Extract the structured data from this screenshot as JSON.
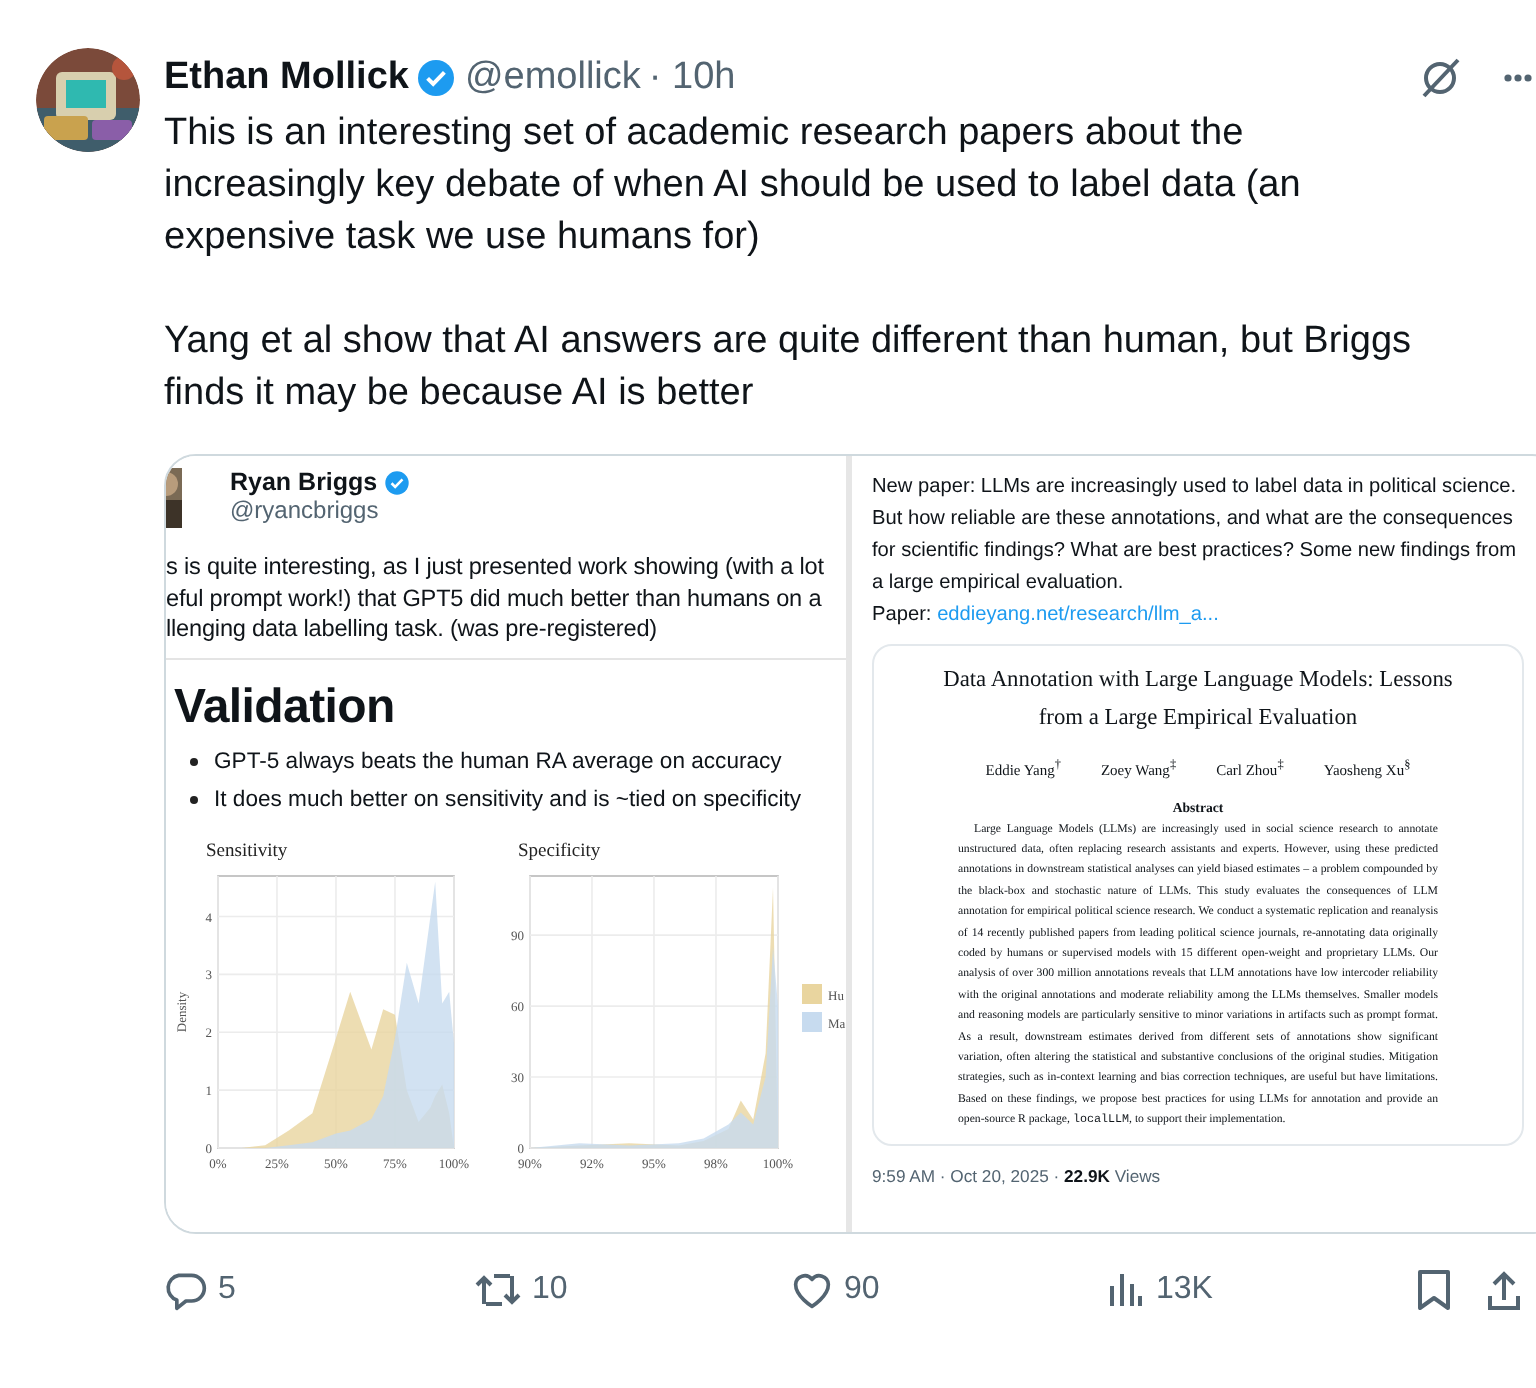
{
  "post": {
    "author": {
      "name": "Ethan Mollick",
      "verified": true,
      "handle": "@emollick",
      "time": "· 10h"
    },
    "paragraphs": [
      [
        "This is an interesting set of academic research papers about the",
        "increasingly key debate of when AI should be used to label data (an",
        "expensive task we use humans for)"
      ],
      [
        "Yang et al show that AI answers are quite different than human, but Briggs",
        "finds it may be because AI is better"
      ]
    ],
    "media": {
      "left": {
        "author": {
          "name": "Ryan Briggs",
          "verified": true,
          "handle": "@ryancbriggs"
        },
        "lines": [
          "s is quite interesting, as I just presented work showing (with a lot",
          "eful prompt work!) that GPT5 did much better than humans on a",
          "llenging data labelling task. (was pre-registered)"
        ],
        "slide": {
          "heading": "Validation",
          "bullets": [
            "GPT-5 always beats the human RA average on accuracy",
            "It does much better on sensitivity and is ~tied on specificity"
          ]
        },
        "charts": [
          {
            "chart_data": {
              "type": "area",
              "title": "Sensitivity",
              "ylabel": "Density",
              "x": [
                0,
                0.1,
                0.2,
                0.3,
                0.4,
                0.5,
                0.56,
                0.65,
                0.7,
                0.75,
                0.8,
                0.85,
                0.9,
                0.92,
                0.95,
                0.98,
                1.0
              ],
              "series": [
                {
                  "color": "#e9d59f",
                  "values": [
                    0,
                    0,
                    0.05,
                    0.3,
                    0.6,
                    1.9,
                    2.7,
                    1.7,
                    2.4,
                    2.3,
                    1.0,
                    0.45,
                    0.7,
                    0.9,
                    1.1,
                    0.6,
                    0
                  ]
                },
                {
                  "color": "#c7dbef",
                  "values": [
                    0,
                    0,
                    0,
                    0.05,
                    0.1,
                    0.25,
                    0.3,
                    0.5,
                    0.9,
                    1.9,
                    3.2,
                    2.5,
                    4.0,
                    4.6,
                    2.5,
                    2.7,
                    1.8
                  ]
                }
              ],
              "xlim": [
                0,
                1
              ],
              "ylim": [
                0,
                4.7
              ],
              "grid": true,
              "xticks": [
                {
                  "value": 0,
                  "label": "0%"
                },
                {
                  "value": 0.25,
                  "label": "25%"
                },
                {
                  "value": 0.5,
                  "label": "50%"
                },
                {
                  "value": 0.75,
                  "label": "75%"
                },
                {
                  "value": 1,
                  "label": "100%"
                }
              ],
              "yticks": [
                0,
                1,
                2,
                3,
                4
              ]
            }
          },
          {
            "chart_data": {
              "type": "area",
              "title": "Specificity",
              "x": [
                0.9,
                0.92,
                0.94,
                0.96,
                0.97,
                0.98,
                0.985,
                0.99,
                0.995,
                0.998,
                1.0
              ],
              "series": [
                {
                  "name": "Hu",
                  "color": "#e9d59f",
                  "values": [
                    0,
                    1,
                    2,
                    1,
                    3,
                    8,
                    20,
                    12,
                    40,
                    110,
                    0
                  ]
                },
                {
                  "name": "Ma",
                  "color": "#c7dbef",
                  "values": [
                    0,
                    2,
                    1,
                    2,
                    4,
                    10,
                    15,
                    10,
                    30,
                    85,
                    60
                  ]
                }
              ],
              "xlim": [
                0.9,
                1
              ],
              "ylim": [
                0,
                115
              ],
              "grid": true,
              "legend": "right",
              "xticks": [
                {
                  "value": 0.9,
                  "label": "90%"
                },
                {
                  "value": 0.925,
                  "label": "92%"
                },
                {
                  "value": 0.95,
                  "label": "95%"
                },
                {
                  "value": 0.975,
                  "label": "98%"
                },
                {
                  "value": 1,
                  "label": "100%"
                }
              ],
              "yticks": [
                0,
                30,
                60,
                90
              ]
            }
          }
        ]
      },
      "right": {
        "lines": [
          "New paper: LLMs are increasingly used to label data in political science.",
          "But how reliable are these annotations, and what are the consequences",
          "for scientific findings? What are best practices? Some new findings from",
          "a large empirical evaluation."
        ],
        "paper_label": "Paper:",
        "paper_link": "eddieyang.net/research/llm_a...",
        "paper": {
          "title_lines": [
            "Data Annotation with Large Language Models: Lessons",
            "from a Large Empirical Evaluation"
          ],
          "authors": [
            "Eddie Yang$^{†}$",
            "Zoey Wang$^{‡}$",
            "Carl Zhou$^{‡}$",
            "Yaosheng Xu$^{§}$"
          ],
          "abstract_heading": "Abstract",
          "abstract": "Large Language Models (LLMs) are increasingly used in social science research to annotate unstructured data, often replacing research assistants and experts. However, using these predicted annotations in downstream statistical analyses can yield biased estimates – a problem compounded by the black-box and stochastic nature of LLMs. This study evaluates the consequences of LLM annotation for empirical political science research. We conduct a systematic replication and reanalysis of 14 recently published papers from leading political science journals, re-annotating data originally coded by humans or supervised models with 15 different open-weight and proprietary LLMs. Our analysis of over 300 million annotations reveals that LLM annotations have low intercoder reliability with the original annotations and moderate reliability among the LLMs themselves. Smaller models and reasoning models are particularly sensitive to minor variations in artifacts such as prompt format. As a result, downstream estimates derived from different sets of annotations show significant variation, often altering the statistical and substantive conclusions of the original studies. Mitigation strategies, such as in-context learning and bias correction techniques, are useful but have limitations. Based on these findings, we propose best practices for using LLMs for annotation and provide an open-source R package, ",
          "abstract_code": "localLLM",
          "abstract_end": ", to support their implementation."
        },
        "footer": "9:59 AM · Oct 20, 2025 · **22.9K** Views"
      }
    },
    "actions": [
      {
        "kind": "reply",
        "count": "5"
      },
      {
        "kind": "repost",
        "count": "10"
      },
      {
        "kind": "like",
        "count": "90"
      },
      {
        "kind": "views",
        "count": "13K"
      },
      {
        "kind": "bookmark"
      },
      {
        "kind": "share"
      }
    ]
  }
}
